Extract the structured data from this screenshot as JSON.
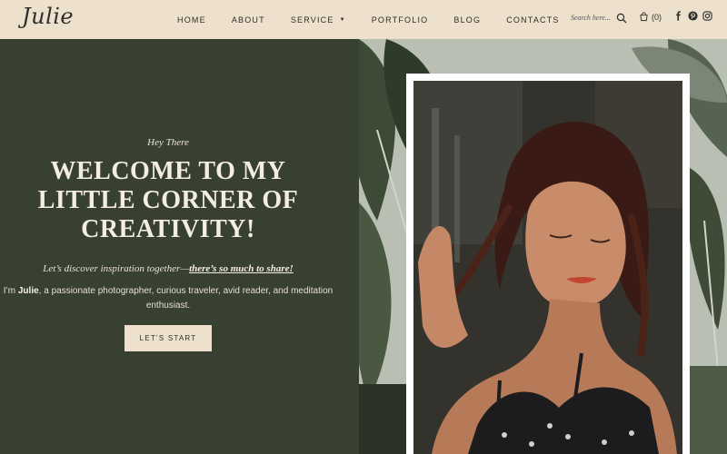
{
  "brand": {
    "logo": "Julie"
  },
  "nav": {
    "items": [
      {
        "label": "HOME"
      },
      {
        "label": "ABOUT"
      },
      {
        "label": "SERVICE"
      },
      {
        "label": "PORTFOLIO"
      },
      {
        "label": "BLOG"
      },
      {
        "label": "CONTACTS"
      }
    ]
  },
  "search": {
    "placeholder": "Search here..."
  },
  "cart": {
    "count": "(0)"
  },
  "hero": {
    "eyebrow": "Hey There",
    "title": "WELCOME TO MY LITTLE CORNER OF CREATIVITY!",
    "tagline_lead": "Let’s discover inspiration together—",
    "tagline_link": "there’s so much to share!",
    "intro_prefix": "I’m ",
    "intro_name": "Julie",
    "intro_rest": ", a passionate photographer, curious traveler, avid reader, and meditation enthusiast.",
    "cta_label": "LET’S START"
  },
  "colors": {
    "header_bg": "#ede0cc",
    "hero_bg": "#384031",
    "accent_text": "#f4ede3"
  },
  "icons": [
    "search-icon",
    "cart-icon",
    "facebook-icon",
    "pinterest-icon",
    "instagram-icon",
    "caret-down-icon"
  ]
}
